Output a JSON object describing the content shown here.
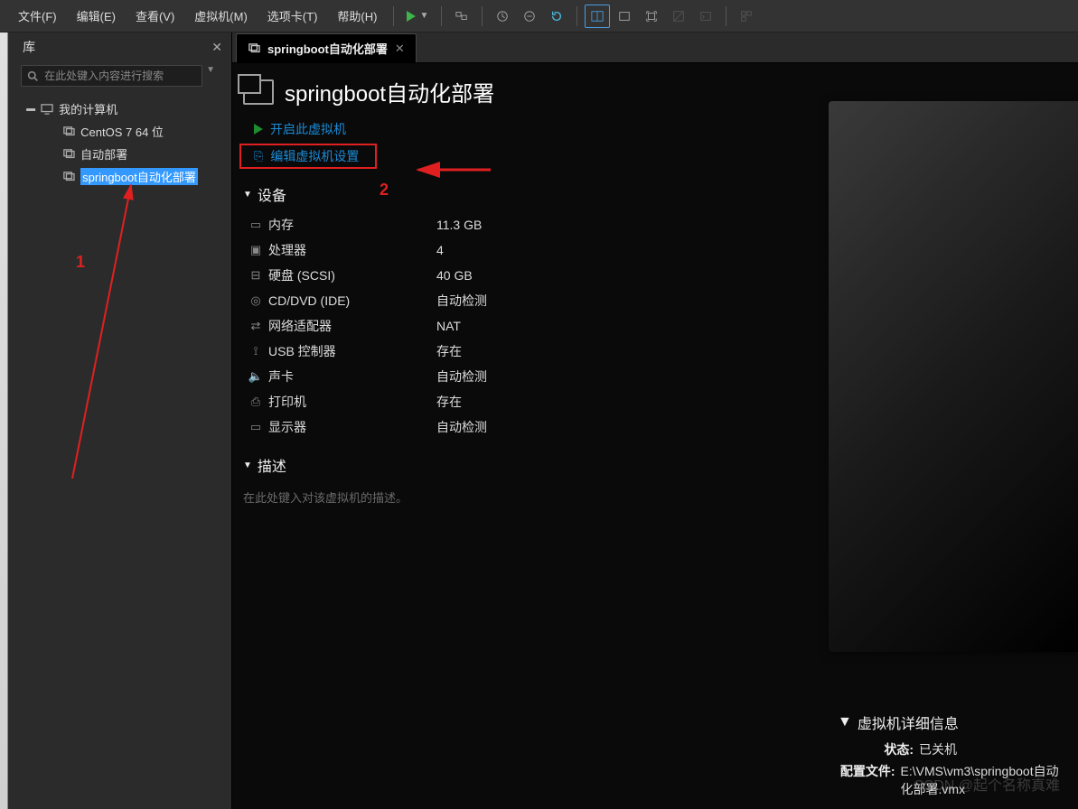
{
  "menubar": {
    "file": "文件(F)",
    "edit": "编辑(E)",
    "view": "查看(V)",
    "vm": "虚拟机(M)",
    "tabs_menu": "选项卡(T)",
    "help": "帮助(H)"
  },
  "sidebar": {
    "title": "库",
    "search_placeholder": "在此处键入内容进行搜索",
    "tree": {
      "root": "我的计算机",
      "items": [
        "CentOS 7 64 位",
        "自动部署",
        "springboot自动化部署"
      ]
    }
  },
  "tabs": [
    {
      "label": "springboot自动化部署"
    }
  ],
  "main": {
    "title": "springboot自动化部署",
    "actions": {
      "power_on": "开启此虚拟机",
      "edit_settings": "编辑虚拟机设置"
    }
  },
  "devices": {
    "header": "设备",
    "rows": [
      {
        "name": "内存",
        "value": "11.3 GB",
        "icon": "memory"
      },
      {
        "name": "处理器",
        "value": "4",
        "icon": "cpu"
      },
      {
        "name": "硬盘 (SCSI)",
        "value": "40 GB",
        "icon": "disk"
      },
      {
        "name": "CD/DVD (IDE)",
        "value": "自动检测",
        "icon": "cd"
      },
      {
        "name": "网络适配器",
        "value": "NAT",
        "icon": "net"
      },
      {
        "name": "USB 控制器",
        "value": "存在",
        "icon": "usb"
      },
      {
        "name": "声卡",
        "value": "自动检测",
        "icon": "sound"
      },
      {
        "name": "打印机",
        "value": "存在",
        "icon": "printer"
      },
      {
        "name": "显示器",
        "value": "自动检测",
        "icon": "display"
      }
    ]
  },
  "description": {
    "header": "描述",
    "placeholder": "在此处键入对该虚拟机的描述。"
  },
  "vm_details": {
    "header": "虚拟机详细信息",
    "state_label": "状态:",
    "state_value": "已关机",
    "config_label": "配置文件:",
    "config_value": "E:\\VMS\\vm3\\springboot自动化部署.vmx"
  },
  "annotations": {
    "one": "1",
    "two": "2"
  },
  "watermark": "CSDN @起个名称真难"
}
